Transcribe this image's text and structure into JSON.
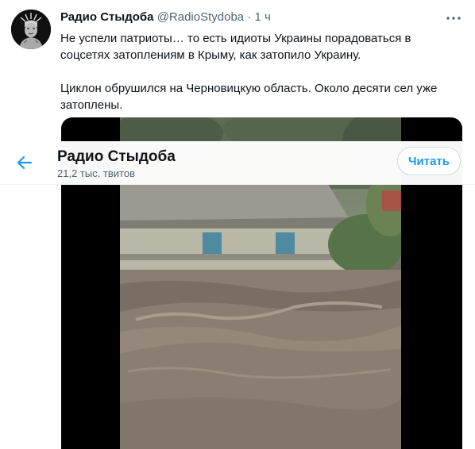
{
  "tweet": {
    "author_name": "Радио Стыдоба",
    "author_handle": "@RadioStydoba",
    "separator": "·",
    "time": "1 ч",
    "paragraph_1": "Не успели патриоты… то есть идиоты Украины порадоваться в соцсетях затоплениям в Крыму, как затопило Украину.",
    "paragraph_2": "Циклон обрушился на Черновицкую область. Около десяти сел уже затоплены.",
    "more_icon": "more-horizontal-icon",
    "avatar_icon": "statue-avatar-icon"
  },
  "sticky_header": {
    "back_icon": "arrow-left-icon",
    "title": "Радио Стыдоба",
    "subtitle": "21,2 тыс. твитов",
    "follow_label": "Читать"
  },
  "colors": {
    "accent": "#1d9bf0",
    "text_primary": "#0f1419",
    "text_secondary": "#536471"
  }
}
